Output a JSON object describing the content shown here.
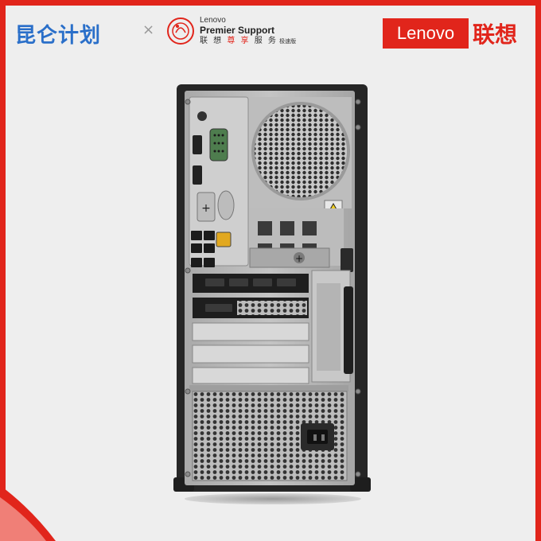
{
  "header": {
    "kunlun_title": "昆仑计划",
    "separator": "×",
    "partner": {
      "lenovo_small": "Lenovo",
      "premier_support": "Premier Support",
      "cn_a": "联 想 ",
      "cn_b": "尊 享",
      "cn_c": " 服 务",
      "cn_d": " 极速版"
    },
    "brand_box": "Lenovo",
    "brand_cn": "联想"
  },
  "colors": {
    "accent_red": "#e1251b",
    "kunlun_blue": "#2a6fc9",
    "background": "#eeeeee",
    "chassis": "#2b2b2b",
    "panel_metal": "#b7b7b7"
  },
  "icons": [
    "premier-support-badge-icon",
    "warning-triangle-icon"
  ]
}
